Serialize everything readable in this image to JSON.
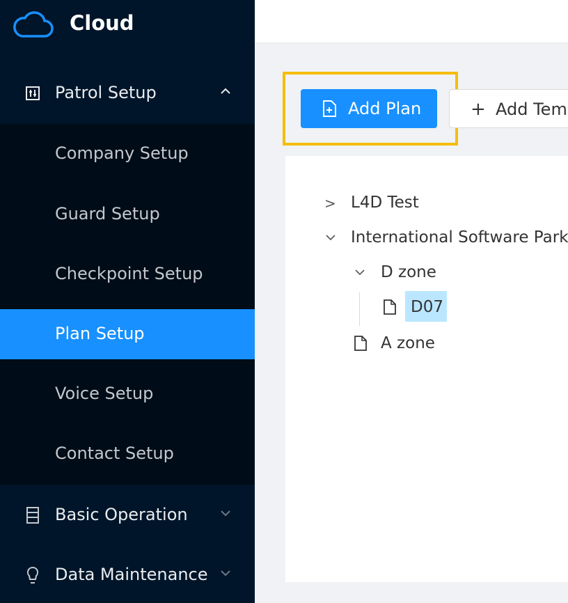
{
  "app": {
    "title": "Cloud"
  },
  "sidebar": {
    "groups": [
      {
        "label": "Patrol Setup",
        "icon": "settings-board-icon",
        "expanded": true
      },
      {
        "label": "Basic Operation",
        "icon": "database-icon",
        "expanded": false
      },
      {
        "label": "Data Maintenance",
        "icon": "bulb-icon",
        "expanded": false
      }
    ],
    "patrol_items": [
      {
        "label": "Company Setup"
      },
      {
        "label": "Guard Setup"
      },
      {
        "label": "Checkpoint Setup"
      },
      {
        "label": "Plan Setup",
        "active": true
      },
      {
        "label": "Voice Setup"
      },
      {
        "label": "Contact Setup"
      }
    ]
  },
  "toolbar": {
    "add_plan_label": "Add Plan",
    "add_template_label": "Add Temp"
  },
  "tree": {
    "nodes": [
      {
        "label": "L4D Test",
        "state": "collapsed"
      },
      {
        "label": "International Software Park",
        "state": "expanded"
      },
      {
        "label": "D zone",
        "state": "expanded"
      },
      {
        "label": "D07",
        "state": "leaf-selected"
      },
      {
        "label": "A zone",
        "state": "leaf"
      }
    ]
  },
  "colors": {
    "sidebar_bg": "#001529",
    "submenu_bg": "#000c17",
    "primary": "#1890ff",
    "highlight": "#f5bd0d",
    "selected_node": "#bae7ff"
  }
}
